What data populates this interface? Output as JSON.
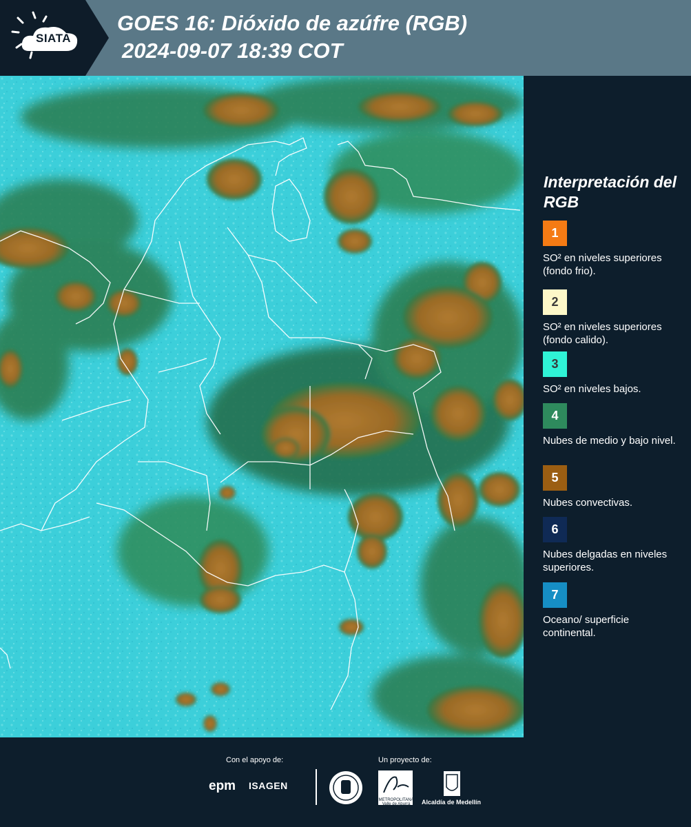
{
  "header": {
    "logo_text": "SIATA",
    "title_line1": "GOES 16: Dióxido de azúfre (RGB)",
    "title_line2": "2024-09-07 18:39 COT"
  },
  "legend": {
    "title": "Interpretación del RGB",
    "items": [
      {
        "number": "1",
        "color": "#f57b14",
        "text_color": "#ffffff",
        "label": "SO² en niveles superiores (fondo frio)."
      },
      {
        "number": "2",
        "color": "#fdf8c8",
        "text_color": "#3a3a3a",
        "label": "SO² en niveles superiores (fondo calido)."
      },
      {
        "number": "3",
        "color": "#2ff3d6",
        "text_color": "#3a3a3a",
        "label": "SO² en niveles bajos."
      },
      {
        "number": "4",
        "color": "#2e8a5d",
        "text_color": "#ffffff",
        "label": "Nubes de medio y bajo nivel."
      },
      {
        "number": "5",
        "color": "#9b5e12",
        "text_color": "#ffffff",
        "label": "Nubes convectivas."
      },
      {
        "number": "6",
        "color": "#0f2a55",
        "text_color": "#ffffff",
        "label": "Nubes delgadas en niveles superiores."
      },
      {
        "number": "7",
        "color": "#168ec4",
        "text_color": "#ffffff",
        "label": "Oceano/ superficie continental."
      }
    ]
  },
  "footer": {
    "support_label": "Con el apoyo de:",
    "project_label": "Un proyecto de:",
    "sponsors": [
      "epm",
      "ISAGEN"
    ],
    "alcaldia": "Alcaldía de Medellín",
    "area_name": "METROPOLITANA Valle de Aburrá"
  },
  "colors": {
    "header_bg": "#5a7887",
    "panel_bg": "#0d1e2c",
    "map_cyan": "#3bd3dc",
    "map_cloud": "#a7712a",
    "map_green": "#2e8a5d"
  }
}
